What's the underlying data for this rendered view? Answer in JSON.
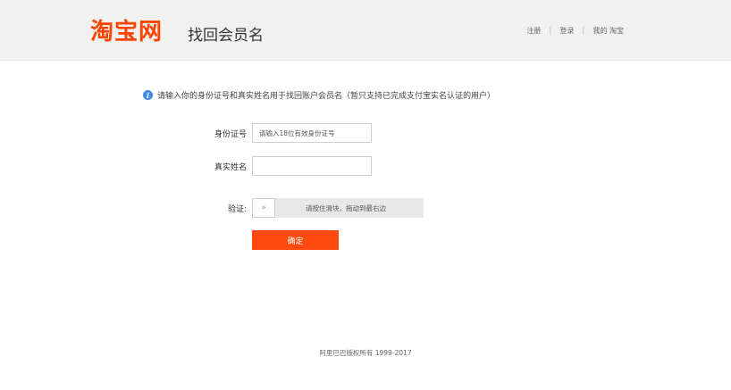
{
  "header": {
    "logo": "淘宝网",
    "title": "找回会员名",
    "nav": {
      "register": "注册",
      "separator": "|",
      "login": "登录",
      "my_taobao": "我的 淘宝"
    }
  },
  "notice": {
    "icon": "info-icon",
    "text": "请输入你的身份证号和真实姓名用于找回账户会员名（暂只支持已完成支付宝实名认证的用户）"
  },
  "form": {
    "id_number": {
      "label": "身份证号",
      "placeholder": "请输入18位有效身份证号",
      "value": ""
    },
    "real_name": {
      "label": "真实姓名",
      "placeholder": "",
      "value": ""
    },
    "verify": {
      "label": "验证:",
      "handle_glyph": "»",
      "hint": "请按住滑块，拖动到最右边"
    },
    "submit_label": "确定"
  },
  "footer": {
    "copyright": "阿里巴巴版权所有 1999-2017"
  },
  "colors": {
    "brand": "#ff4400",
    "button": "#ff4a0f",
    "info": "#3e8ae6",
    "header_bg": "#f1f1f1"
  }
}
